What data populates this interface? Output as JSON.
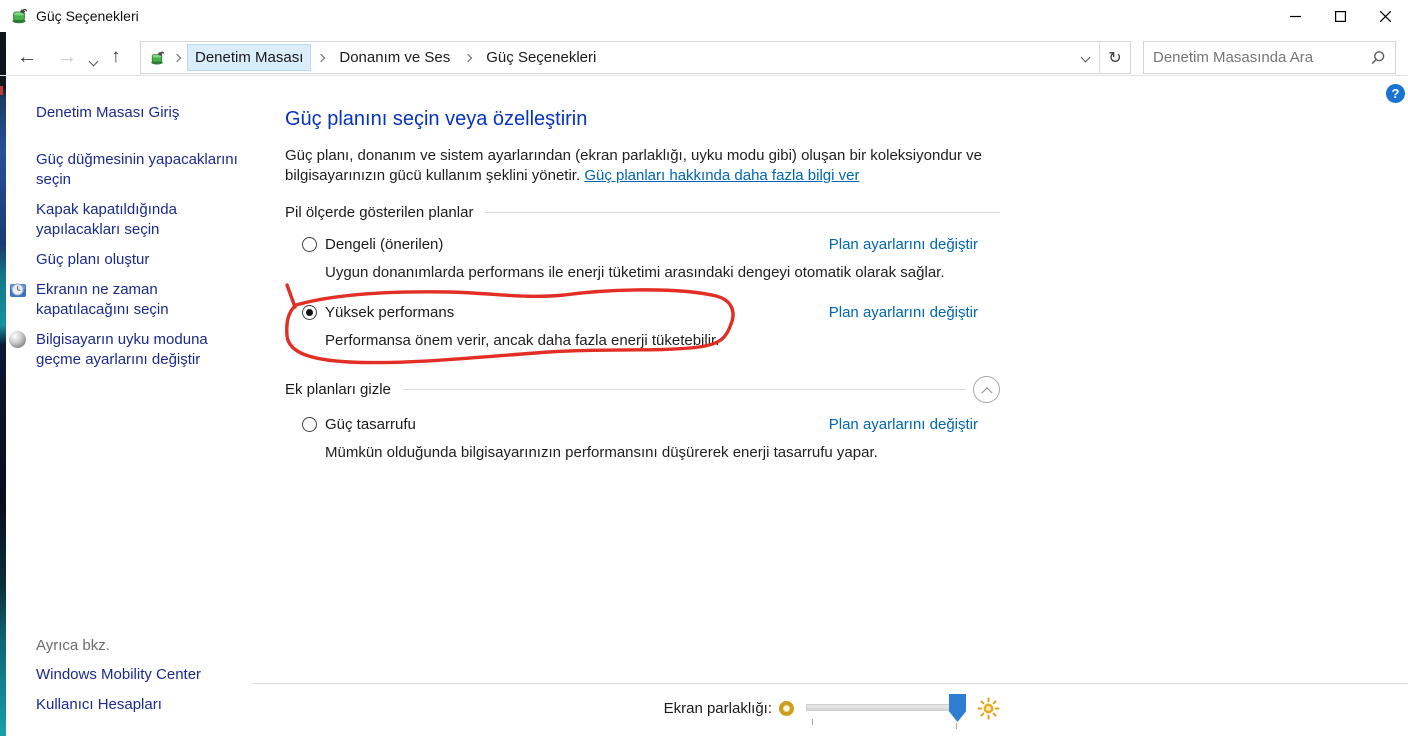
{
  "window": {
    "title": "Güç Seçenekleri"
  },
  "toolbar": {
    "breadcrumb": {
      "items": [
        "Denetim Masası",
        "Donanım ve Ses",
        "Güç Seçenekleri"
      ]
    },
    "search": {
      "placeholder": "Denetim Masasında Ara"
    }
  },
  "sidebar": {
    "home": "Denetim Masası Giriş",
    "tasks": [
      {
        "label": "Güç düğmesinin yapacaklarını seçin",
        "icon": null
      },
      {
        "label": "Kapak kapatıldığında yapılacakları seçin",
        "icon": null
      },
      {
        "label": "Güç planı oluştur",
        "icon": null
      },
      {
        "label": "Ekranın ne zaman kapatılacağını seçin",
        "icon": "monitor-clock-icon"
      },
      {
        "label": "Bilgisayarın uyku moduna geçme ayarlarını değiştir",
        "icon": "sleep-sphere-icon"
      }
    ],
    "see_also_header": "Ayrıca bkz.",
    "see_also_links": [
      "Windows Mobility Center",
      "Kullanıcı Hesapları"
    ]
  },
  "main": {
    "heading": "Güç planını seçin veya özelleştirin",
    "intro_text": "Güç planı, donanım ve sistem ayarlarından (ekran parlaklığı, uyku modu gibi) oluşan bir koleksiyondur ve bilgisayarınızın gücü kullanım şeklini yönetir. ",
    "intro_link": "Güç planları hakkında daha fazla bilgi ver",
    "section_battery": "Pil ölçerde gösterilen planlar",
    "section_additional": "Ek planları gizle",
    "plan_settings_link": "Plan ayarlarını değiştir",
    "plans": [
      {
        "name": "Dengeli (önerilen)",
        "description": "Uygun donanımlarda performans ile enerji tüketimi arasındaki dengeyi otomatik olarak sağlar.",
        "selected": false,
        "annotated": false
      },
      {
        "name": "Yüksek performans",
        "description": "Performansa önem verir, ancak daha fazla enerji tüketebilir.",
        "selected": true,
        "annotated": true
      },
      {
        "name": "Güç tasarrufu",
        "description": "Mümkün olduğunda bilgisayarınızın performansını düşürerek enerji tasarrufu yapar.",
        "selected": false,
        "annotated": false
      }
    ]
  },
  "footer": {
    "brightness_label": "Ekran parlaklığı:"
  },
  "help": {
    "glyph": "?"
  },
  "colors": {
    "heading_blue": "#0433bf",
    "sidebar_navy": "#1b2a8e",
    "link_blue": "#0066b4",
    "annotation_red": "#e02318",
    "slider_blue": "#2d7dd2",
    "breadcrumb_highlight": "#d9edfb"
  }
}
